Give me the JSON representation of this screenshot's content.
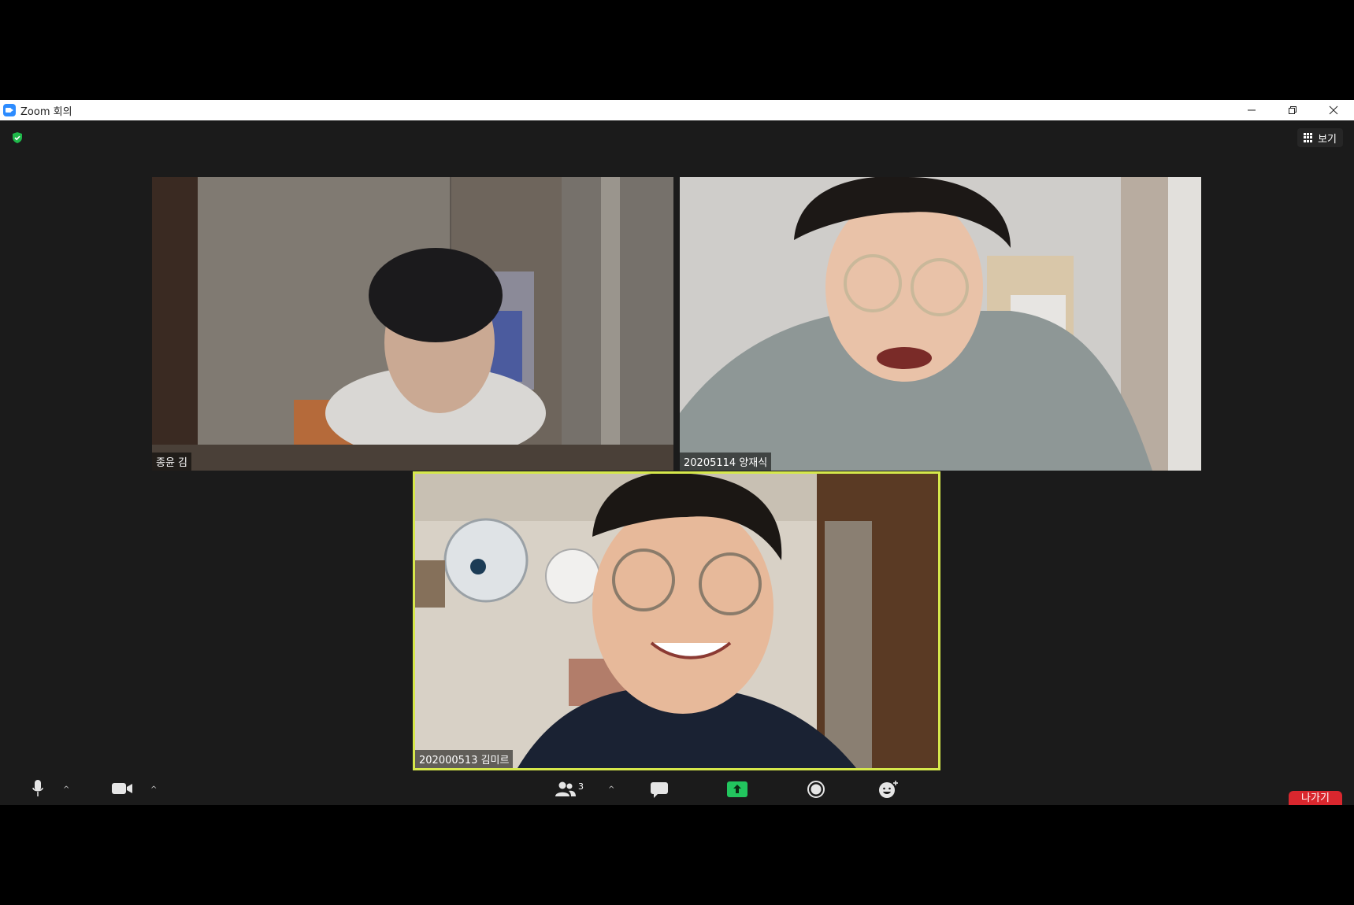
{
  "window": {
    "title": "Zoom 회의",
    "controls": {
      "minimize": "—",
      "restore": "❐",
      "close": "✕"
    }
  },
  "header": {
    "view_label": "보기"
  },
  "participants": [
    {
      "name": "종윤 김"
    },
    {
      "name": "20205114 양재식"
    },
    {
      "name": "202000513 김미르",
      "active_speaker": true
    }
  ],
  "toolbar": {
    "participants_count": "3",
    "leave_label": "나가기"
  },
  "colors": {
    "active_speaker_border": "#d6e84b",
    "share_green": "#22c55e",
    "leave_red": "#d9272e",
    "shield_green": "#1fb84a"
  }
}
